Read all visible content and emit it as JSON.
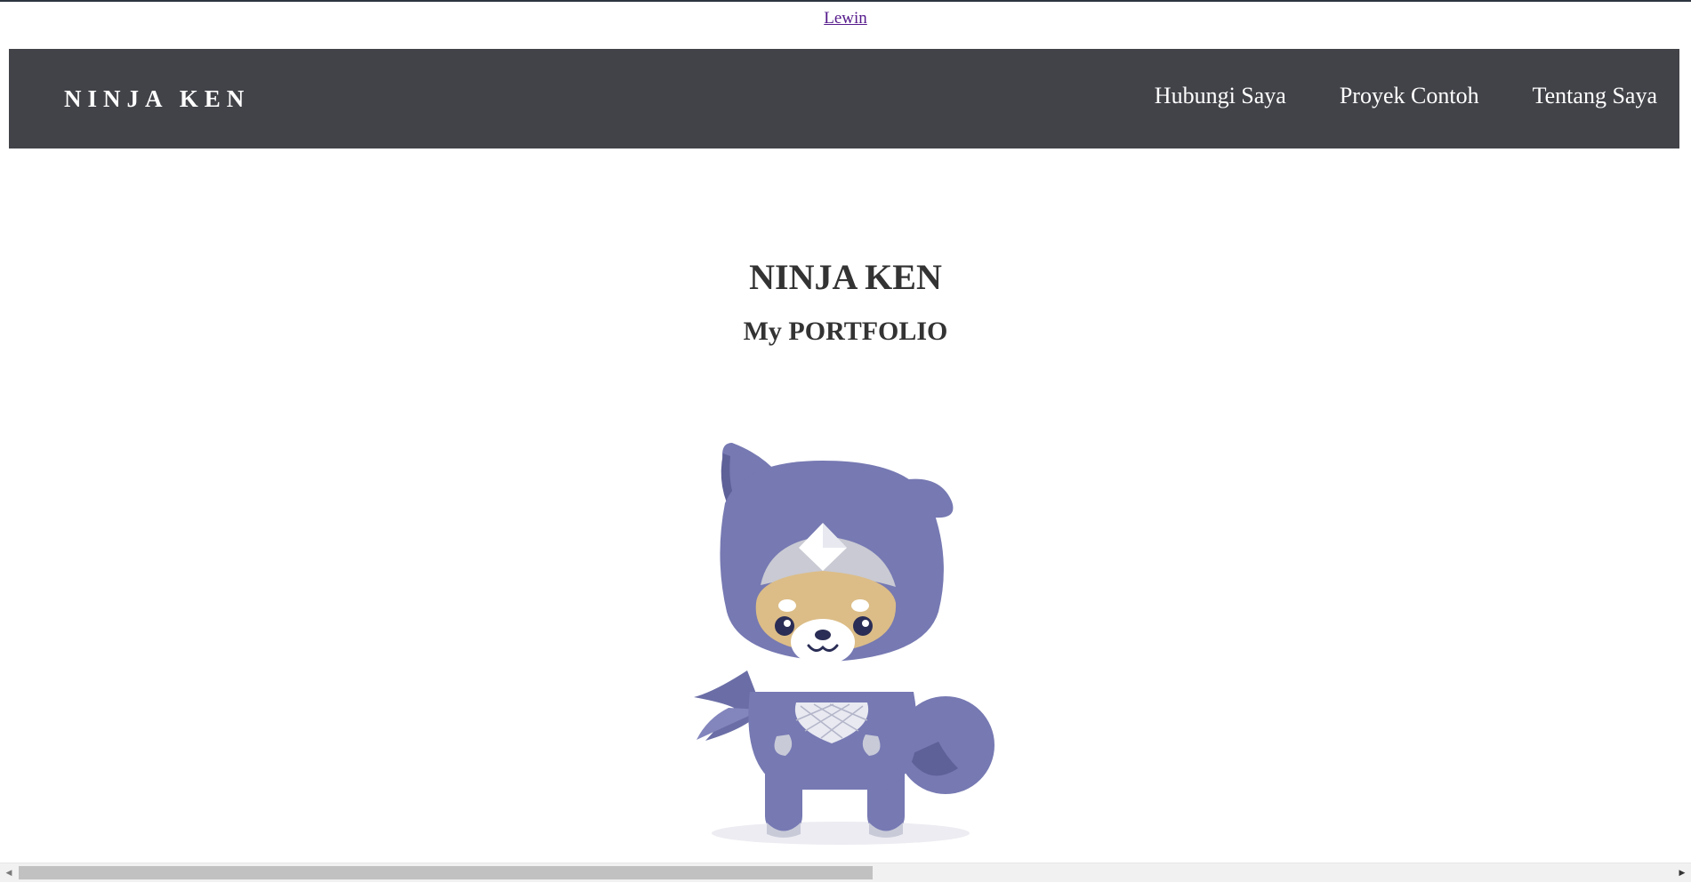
{
  "top_link": {
    "label": "Lewin"
  },
  "header": {
    "brand": "NINJA KEN",
    "nav": [
      {
        "label": "Hubungi Saya"
      },
      {
        "label": "Proyek Contoh"
      },
      {
        "label": "Tentang Saya"
      }
    ]
  },
  "hero": {
    "title": "NINJA KEN",
    "subtitle": "My PORTFOLIO"
  },
  "mascot": {
    "icon": "ninja-dog-mascot"
  },
  "colors": {
    "navbar": "#424349",
    "mascot_body": "#7679b2",
    "mascot_face": "#dcbd87",
    "text": "#333333",
    "link": "#551a8b"
  },
  "scrollbar": {
    "left_icon": "scroll-left-arrow-icon",
    "right_icon": "scroll-right-arrow-icon"
  }
}
